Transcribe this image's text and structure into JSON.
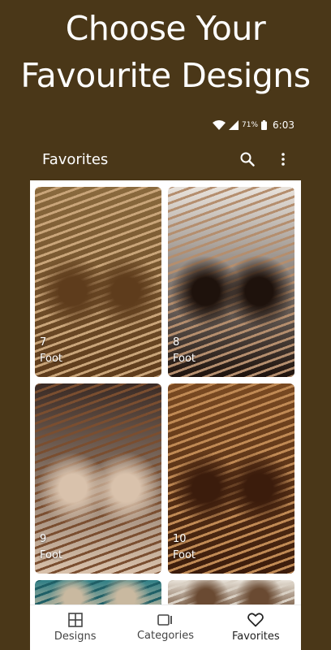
{
  "promo": {
    "line1": "Choose Your",
    "line2": "Favourite Designs"
  },
  "status_bar": {
    "battery": "71%",
    "time": "6:03",
    "icons": [
      "wifi-icon",
      "signal-icon",
      "battery-icon"
    ]
  },
  "app_bar": {
    "title": "Favorites",
    "actions": [
      "search-icon",
      "more-vert-icon"
    ]
  },
  "designs": [
    {
      "number": "7",
      "category": "Foot",
      "palette": [
        "#8a6a3e",
        "#5e3c1c",
        "#c9a57a"
      ]
    },
    {
      "number": "8",
      "category": "Foot",
      "palette": [
        "#e9e3dc",
        "#1e120c",
        "#b48e6e"
      ]
    },
    {
      "number": "9",
      "category": "Foot",
      "palette": [
        "#3a2a24",
        "#d9c2ac",
        "#7a4e30"
      ]
    },
    {
      "number": "10",
      "category": "Foot",
      "palette": [
        "#7a4a22",
        "#3b1c0c",
        "#c08a55"
      ]
    },
    {
      "number": "",
      "category": "",
      "palette": [
        "#2f7f86",
        "#c9b9a0",
        "#1f5f66"
      ]
    },
    {
      "number": "",
      "category": "",
      "palette": [
        "#e8e2d8",
        "#6a4a32",
        "#d9d0c4"
      ]
    }
  ],
  "bottom_nav": {
    "items": [
      {
        "label": "Designs",
        "icon": "grid-icon"
      },
      {
        "label": "Categories",
        "icon": "categories-icon"
      },
      {
        "label": "Favorites",
        "icon": "heart-icon"
      }
    ],
    "active": "Favorites"
  },
  "colors": {
    "background": "#4a3718",
    "surface": "#ffffff",
    "on_background": "#ffffff"
  }
}
